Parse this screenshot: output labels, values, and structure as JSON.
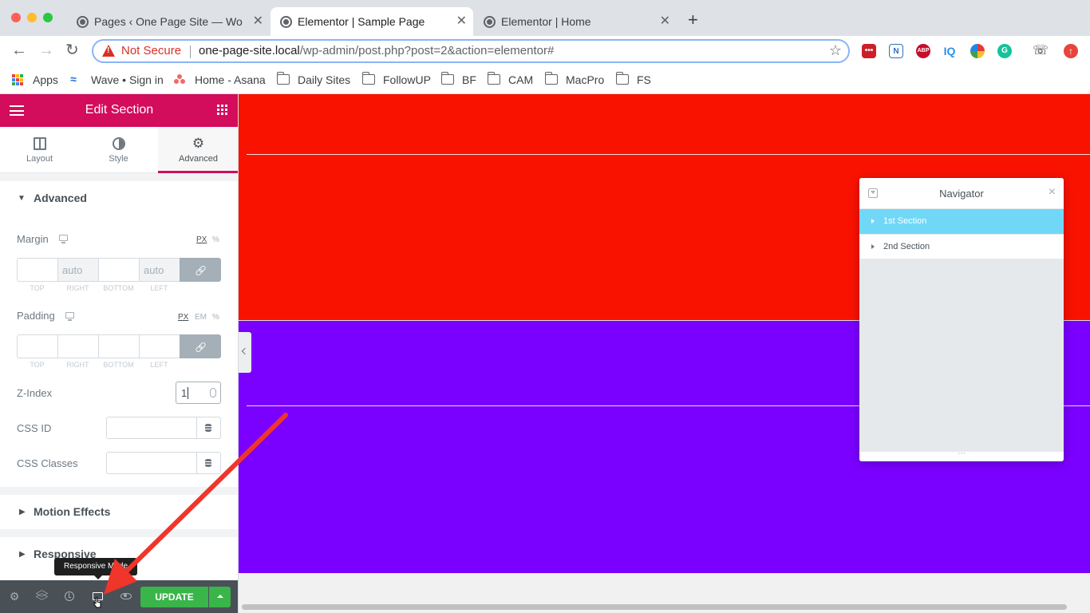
{
  "browser": {
    "tabs": [
      {
        "title": "Pages ‹ One Page Site — WordPress",
        "active": false
      },
      {
        "title": "Elementor | Sample Page",
        "active": true
      },
      {
        "title": "Elementor | Home",
        "active": false
      }
    ],
    "new_tab": "+",
    "address": {
      "security": "Not Secure",
      "domain": "one-page-site.local",
      "path": "/wp-admin/post.php?post=2&action=elementor#"
    },
    "extensions": [
      {
        "name": "lastpass-icon",
        "label": "•••",
        "color": "#cc2029"
      },
      {
        "name": "n-extension-icon",
        "label": "N",
        "color": "#2d6fbd"
      },
      {
        "name": "adblock-icon",
        "label": "ABP",
        "color": "#c70d2c"
      },
      {
        "name": "iq-icon",
        "label": "IQ",
        "color": "#2c8fe8"
      },
      {
        "name": "color-wheel-icon",
        "label": "",
        "color": "#e53935"
      },
      {
        "name": "grammarly-icon",
        "label": "G",
        "color": "#15c39a"
      },
      {
        "name": "phone-icon",
        "label": "☏",
        "color": "#202124"
      },
      {
        "name": "upload-icon",
        "label": "↑",
        "color": "#e8453c"
      }
    ],
    "bookmarks": [
      {
        "label": "Apps",
        "icon": "apps-icon"
      },
      {
        "label": "Wave • Sign in",
        "icon": "wave-icon"
      },
      {
        "label": "Home - Asana",
        "icon": "asana-icon"
      },
      {
        "label": "Daily Sites",
        "icon": "folder-icon"
      },
      {
        "label": "FollowUP",
        "icon": "folder-icon"
      },
      {
        "label": "BF",
        "icon": "folder-icon"
      },
      {
        "label": "CAM",
        "icon": "folder-icon"
      },
      {
        "label": "MacPro",
        "icon": "folder-icon"
      },
      {
        "label": "FS",
        "icon": "folder-icon"
      }
    ]
  },
  "panel": {
    "title": "Edit Section",
    "accent": "#d30c5c",
    "tabs": [
      {
        "label": "Layout",
        "active": false
      },
      {
        "label": "Style",
        "active": false
      },
      {
        "label": "Advanced",
        "active": true
      }
    ],
    "advanced": {
      "heading": "Advanced",
      "margin": {
        "label": "Margin",
        "units": [
          "PX",
          "%"
        ],
        "selected_unit": "PX",
        "values": {
          "top": "",
          "right": "auto",
          "bottom": "",
          "left": "auto"
        },
        "sides": [
          "TOP",
          "RIGHT",
          "BOTTOM",
          "LEFT"
        ]
      },
      "padding": {
        "label": "Padding",
        "units": [
          "PX",
          "EM",
          "%"
        ],
        "selected_unit": "PX",
        "values": {
          "top": "",
          "right": "",
          "bottom": "",
          "left": ""
        },
        "sides": [
          "TOP",
          "RIGHT",
          "BOTTOM",
          "LEFT"
        ]
      },
      "z_index": {
        "label": "Z-Index",
        "value": "1"
      },
      "css_id": {
        "label": "CSS ID",
        "value": ""
      },
      "css_classes": {
        "label": "CSS Classes",
        "value": ""
      }
    },
    "collapsed_sections": [
      "Motion Effects",
      "Responsive"
    ],
    "footer": {
      "update_label": "UPDATE",
      "tooltip": "Responsive Mode",
      "update_color": "#39b54a"
    }
  },
  "canvas": {
    "section1_color": "#f91200",
    "section2_color": "#7a00ff"
  },
  "navigator": {
    "title": "Navigator",
    "close": "×",
    "items": [
      {
        "label": "1st Section",
        "active": true
      },
      {
        "label": "2nd Section",
        "active": false
      }
    ],
    "resize_handle": "⋯"
  }
}
